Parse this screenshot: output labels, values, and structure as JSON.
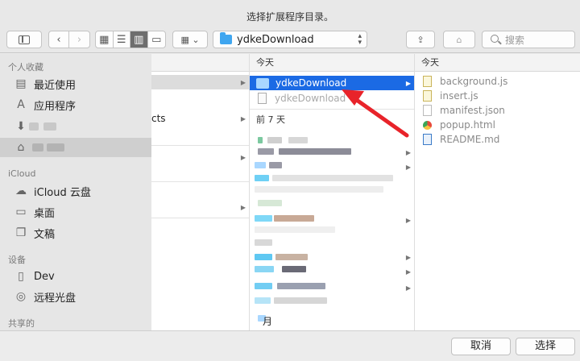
{
  "window": {
    "title": "选择扩展程序目录。"
  },
  "toolbar": {
    "path_selector": "ydkeDownload",
    "search_placeholder": "搜索"
  },
  "sidebar": {
    "sections": {
      "favorites": "个人收藏",
      "icloud": "iCloud",
      "devices": "设备",
      "shared": "共享的"
    },
    "items": {
      "recents": "最近使用",
      "applications": "应用程序",
      "icloud_drive": "iCloud 云盘",
      "desktop": "桌面",
      "documents": "文稿",
      "dev": "Dev",
      "remote_disc": "远程光盘"
    }
  },
  "column1": {
    "partial_text": "cts"
  },
  "column2": {
    "header": "今天",
    "items": [
      "ydkeDownload",
      "ydkeDownload"
    ],
    "section_7days": "前 7 天",
    "partial_month": "月"
  },
  "column3": {
    "header": "今天",
    "files": [
      "background.js",
      "insert.js",
      "manifest.json",
      "popup.html",
      "README.md"
    ]
  },
  "buttons": {
    "cancel": "取消",
    "choose": "选择"
  },
  "colors": {
    "selection": "#1b6ae4",
    "folder": "#3fa6f0",
    "annotation_arrow": "#e8232a"
  }
}
